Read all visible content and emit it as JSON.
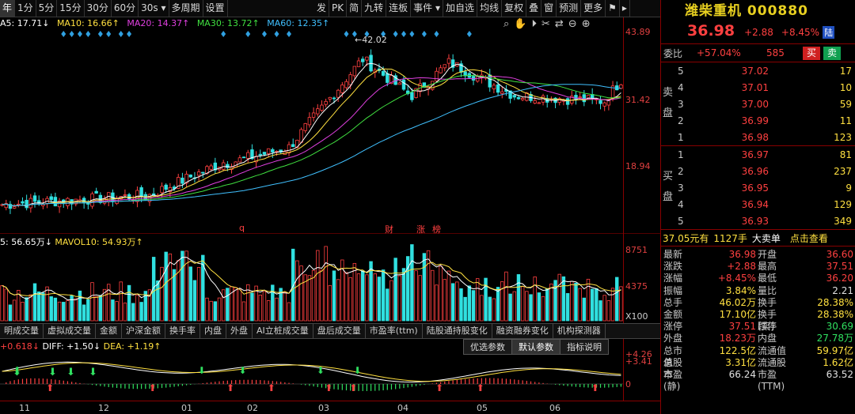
{
  "toolbar": {
    "left_items": [
      "年",
      "1分",
      "5分",
      "15分",
      "30分",
      "60分",
      "30s",
      "多周期",
      "设置"
    ],
    "active_item": "年",
    "right_items": [
      "发",
      "PK",
      "简",
      "九转",
      "连板",
      "事件",
      "加自选",
      "均线",
      "复权",
      "叠",
      "窗",
      "预测",
      "更多"
    ],
    "nav_icons": [
      "flag-icon",
      "search-icon",
      "hand-icon",
      "play-icon",
      "scissors-icon",
      "shuffle-icon",
      "minus-icon",
      "plus-icon"
    ]
  },
  "ma_legend": {
    "ma5": "A5: 17.71↓",
    "ma10": "MA10: 16.66↑",
    "ma20": "MA20: 14.37↑",
    "ma30": "MA30: 13.72↑",
    "ma60": "MA60: 12.35↑"
  },
  "price_axis": {
    "top": "43.89",
    "mid": "31.42",
    "low": "18.94"
  },
  "high_annotation": "42.02",
  "event_markers": [
    "q",
    "财",
    "涨",
    "榜"
  ],
  "vol_legend": {
    "vol": "5: 56.65万↓",
    "mavol10": "MAVOL10: 54.93万↑"
  },
  "vol_axis": {
    "top": "8751",
    "mid": "4375",
    "unit": "X100"
  },
  "indicator_tabs": [
    "明成交量",
    "虚拟成交量",
    "金额",
    "沪深金额",
    "换手率",
    "内盘",
    "外盘",
    "AI立桩成交量",
    "盘后成交量",
    "市盈率(ttm)",
    "陆股通持股变化",
    "融资融券变化",
    "机构探测器"
  ],
  "macd_legend": {
    "macd": "+0.618↓",
    "diff": "DIFF: +1.50↓",
    "dea": "DEA: +1.19↑"
  },
  "macd_buttons": [
    "优选参数",
    "默认参数",
    "指标说明"
  ],
  "macd_axis": {
    "top": "+4.26",
    "second": "+3.41",
    "zero": "0"
  },
  "date_ticks": [
    "11",
    "12",
    "01",
    "02",
    "03",
    "04",
    "05",
    "06"
  ],
  "stock": {
    "name": "潍柴重机",
    "code": "000880",
    "price": "36.98",
    "change": "+2.88",
    "pct": "+8.45%",
    "badge": "陆"
  },
  "weibi": {
    "label": "委比",
    "value": "+57.04%",
    "diff": "585",
    "buy": "买",
    "sell": "卖"
  },
  "sell_book": {
    "label": "卖盘",
    "rows": [
      {
        "lvl": "5",
        "px": "37.02",
        "vol": "17"
      },
      {
        "lvl": "4",
        "px": "37.01",
        "vol": "10"
      },
      {
        "lvl": "3",
        "px": "37.00",
        "vol": "59"
      },
      {
        "lvl": "2",
        "px": "36.99",
        "vol": "11"
      },
      {
        "lvl": "1",
        "px": "36.98",
        "vol": "123"
      }
    ]
  },
  "buy_book": {
    "label": "买盘",
    "rows": [
      {
        "lvl": "1",
        "px": "36.97",
        "vol": "81"
      },
      {
        "lvl": "2",
        "px": "36.96",
        "vol": "237"
      },
      {
        "lvl": "3",
        "px": "36.95",
        "vol": "9"
      },
      {
        "lvl": "4",
        "px": "36.94",
        "vol": "129"
      },
      {
        "lvl": "5",
        "px": "36.93",
        "vol": "349"
      }
    ]
  },
  "deal": {
    "price": "37.05元有",
    "hand": "1127手",
    "big": "大卖单",
    "link": "点击查看"
  },
  "stats": [
    {
      "k1": "最新",
      "v1": "36.98",
      "k2": "开盘",
      "v2": "36.60"
    },
    {
      "k1": "涨跌",
      "v1": "+2.88",
      "k2": "最高",
      "v2": "37.51"
    },
    {
      "k1": "涨幅",
      "v1": "+8.45%",
      "k2": "最低",
      "v2": "36.20"
    },
    {
      "k1": "振幅",
      "v1": "3.84%",
      "k2": "量比",
      "v2": "2.21"
    },
    {
      "k1": "总手",
      "v1": "46.02万",
      "k2": "换手",
      "v2": "28.38%"
    },
    {
      "k1": "金额",
      "v1": "17.10亿",
      "k2": "换手(实)",
      "v2": "28.38%"
    },
    {
      "k1": "涨停",
      "v1": "37.51",
      "k2": "跌停",
      "v2": "30.69"
    },
    {
      "k1": "外盘",
      "v1": "18.23万",
      "k2": "内盘",
      "v2": "27.78万"
    },
    {
      "k1": "总市值",
      "v1": "122.5亿",
      "k2": "流通值",
      "v2": "59.97亿"
    },
    {
      "k1": "总股本",
      "v1": "3.31亿",
      "k2": "流通股",
      "v2": "1.62亿"
    },
    {
      "k1": "市盈(静)",
      "v1": "66.24",
      "k2": "市盈(TTM)",
      "v2": "63.52"
    }
  ],
  "colors": {
    "up": "#ff4040",
    "down": "#30e0e0",
    "ma5": "#ffffff",
    "ma10": "#ffe040",
    "ma20": "#e040e0",
    "ma30": "#40e040",
    "ma60": "#40c0ff"
  }
}
